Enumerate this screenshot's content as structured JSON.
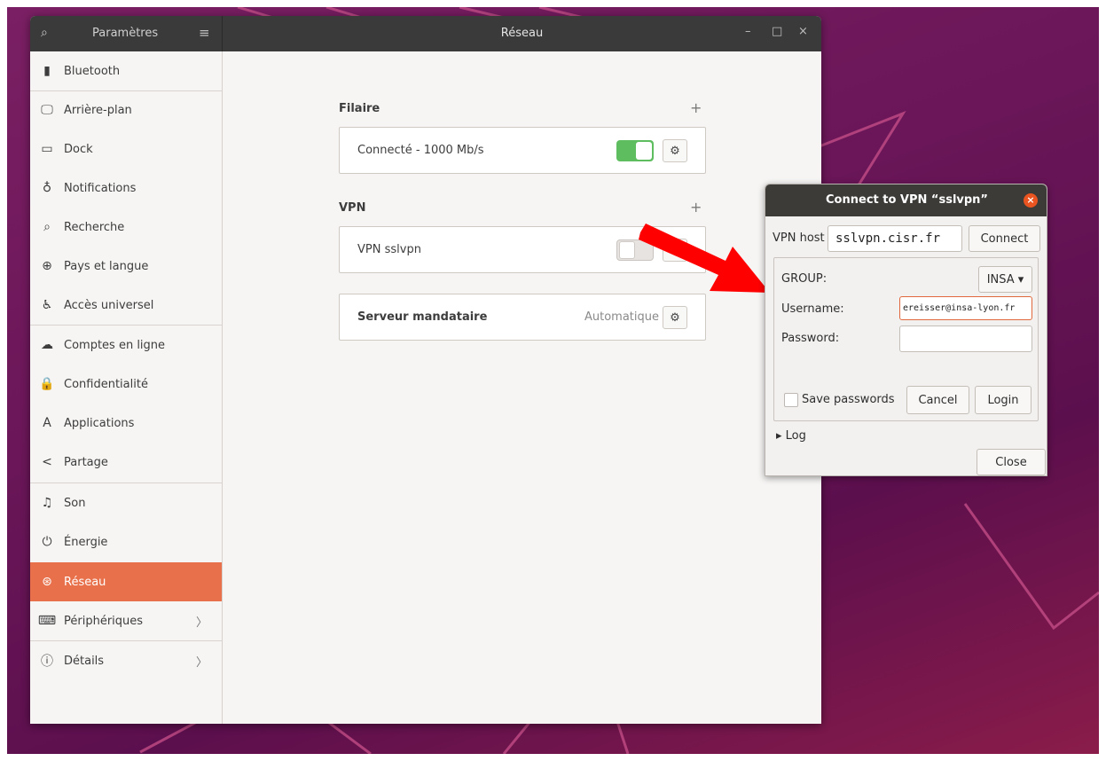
{
  "titlebar": {
    "app_title": "Paramètres",
    "window_title": "Réseau",
    "controls": {
      "minimize": "–",
      "maximize": "□",
      "close": "×"
    }
  },
  "sidebar": {
    "items": [
      {
        "label": "Bluetooth",
        "icon": "bluetooth-icon",
        "glyph": "▮"
      },
      {
        "label": "Arrière-plan",
        "icon": "monitor-icon",
        "glyph": "🖵"
      },
      {
        "label": "Dock",
        "icon": "dock-icon",
        "glyph": "▭"
      },
      {
        "label": "Notifications",
        "icon": "bell-icon",
        "glyph": "♁"
      },
      {
        "label": "Recherche",
        "icon": "search-icon",
        "glyph": "⌕"
      },
      {
        "label": "Pays et langue",
        "icon": "globe-icon",
        "glyph": "⊕"
      },
      {
        "label": "Accès universel",
        "icon": "accessibility-icon",
        "glyph": "♿"
      },
      {
        "label": "Comptes en ligne",
        "icon": "cloud-icon",
        "glyph": "☁"
      },
      {
        "label": "Confidentialité",
        "icon": "lock-icon",
        "glyph": "🔒"
      },
      {
        "label": "Applications",
        "icon": "applications-icon",
        "glyph": "A"
      },
      {
        "label": "Partage",
        "icon": "share-icon",
        "glyph": "<"
      },
      {
        "label": "Son",
        "icon": "music-note-icon",
        "glyph": "♫"
      },
      {
        "label": "Énergie",
        "icon": "power-icon",
        "glyph": "⏻"
      },
      {
        "label": "Réseau",
        "icon": "network-icon",
        "glyph": "⊛"
      },
      {
        "label": "Périphériques",
        "icon": "devices-icon",
        "glyph": "⌨"
      },
      {
        "label": "Détails",
        "icon": "info-icon",
        "glyph": "ⓘ"
      }
    ],
    "chevron": "〉"
  },
  "network": {
    "wired": {
      "title": "Filaire",
      "add": "+",
      "status": "Connecté - 1000 Mb/s"
    },
    "vpn": {
      "title": "VPN",
      "add": "+",
      "name": "VPN sslvpn"
    },
    "proxy": {
      "label": "Serveur mandataire",
      "value": "Automatique"
    }
  },
  "dialog": {
    "title": "Connect to VPN “sslvpn”",
    "close": "×",
    "vpn_host_label": "VPN host",
    "vpn_host_value": "sslvpn.cisr.fr",
    "connect_label": "Connect",
    "group_label": "GROUP:",
    "group_value": "INSA ▾",
    "username_label": "Username:",
    "username_value": "ereisser@insa-lyon.fr",
    "password_label": "Password:",
    "password_value": "",
    "save_passwords_label": "Save passwords",
    "cancel_label": "Cancel",
    "login_label": "Login",
    "log_label": "▸ Log",
    "close_label": "Close"
  },
  "colors": {
    "accent": "#e8704a",
    "switch_on": "#5ebd5e",
    "arrow": "#ff0000",
    "dialog_close": "#e95420"
  }
}
